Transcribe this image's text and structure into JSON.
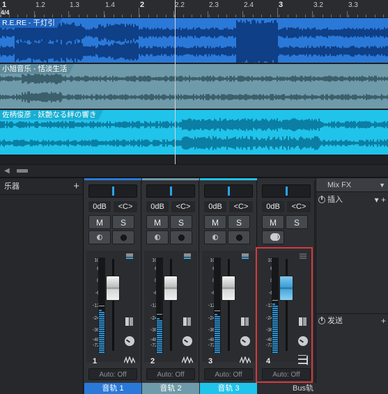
{
  "ruler": {
    "labels": [
      "1",
      "1.2",
      "1.3",
      "1.4",
      "2",
      "2.2",
      "2.3",
      "2.4",
      "3",
      "3.2",
      "3.3"
    ],
    "time_signature": "4/4"
  },
  "tracks": [
    {
      "title": "R.E.RE - 干灯引",
      "color": "#2a79d8",
      "title_bg": "#1f64be",
      "wave_color": "#0f3f86"
    },
    {
      "title": "小旭音乐 - 恬淡生活",
      "color": "#6f9aa9",
      "title_bg": "#5f8b9b",
      "wave_color": "#3c5f6c"
    },
    {
      "title": "佐柄俊彦 - 妖艶なる絆の響き",
      "color": "#20c3ea",
      "title_bg": "#18aed4",
      "wave_color": "#0c7ea3"
    }
  ],
  "mixer": {
    "instrument_label": "乐器",
    "add_label": "+",
    "scale_marks": [
      "10",
      "6",
      "0",
      "-6",
      "-12",
      "-24",
      "-36",
      "-48",
      "-72"
    ],
    "strips": [
      {
        "volume": "0dB",
        "pan": "<C>",
        "mute": "M",
        "solo": "S",
        "number": "1",
        "automation": "Auto: Off",
        "name": "音轨 1",
        "color": "#2a79d8",
        "meter_fill": 0.46,
        "fader_level": 0.78
      },
      {
        "volume": "0dB",
        "pan": "<C>",
        "mute": "M",
        "solo": "S",
        "number": "2",
        "automation": "Auto: Off",
        "name": "音轨 2",
        "color": "#6f9aa9",
        "meter_fill": 0.37,
        "fader_level": 0.78
      },
      {
        "volume": "0dB",
        "pan": "<C>",
        "mute": "M",
        "solo": "S",
        "number": "3",
        "automation": "Auto: Off",
        "name": "音轨 3",
        "color": "#20c3ea",
        "meter_fill": 0.41,
        "fader_level": 0.78
      },
      {
        "volume": "0dB",
        "pan": "<C>",
        "mute": "M",
        "solo": "S",
        "number": "4",
        "automation": "Auto: Off",
        "name": "Bus轨",
        "color": "#2b2d31",
        "meter_fill": 0.52,
        "fader_level": 0.78,
        "is_bus": true
      }
    ],
    "fx_panel": {
      "title": "Mix FX",
      "inserts_label": "插入",
      "sends_label": "发送",
      "add": "+"
    }
  }
}
